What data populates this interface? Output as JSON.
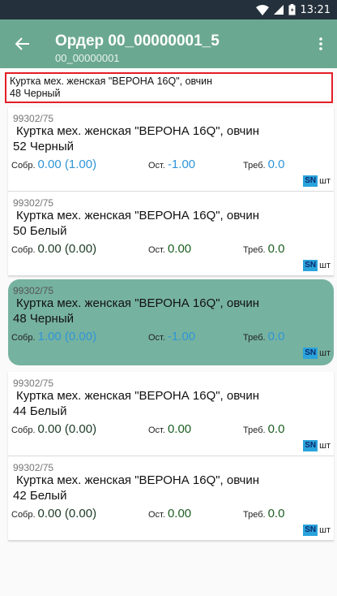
{
  "statusbar": {
    "time": "13:21"
  },
  "appbar": {
    "title": "Ордер 00_00000001_5",
    "subtitle": "00_00000001"
  },
  "selected": {
    "line1": "Куртка мех. женская \"ВЕРОНА 16Q\", овчин",
    "line2": "48 Черный"
  },
  "labels": {
    "collected": "Собр.",
    "remaining": "Ост.",
    "required": "Треб.",
    "sn": "SN",
    "unit": "шт"
  },
  "colors": {
    "blue": "#2f95d6",
    "green": "#1b5e20",
    "dark": "#1b3a24",
    "accent": "#6ba892"
  },
  "items": [
    {
      "code": "99302/75",
      "name": "Куртка мех. женская \"ВЕРОНА 16Q\", овчин",
      "variant": "52 Черный",
      "collected": "0.00 (1.00)",
      "remaining": "-1.00",
      "required": "0.0",
      "style": "blue",
      "highlight": false
    },
    {
      "code": "99302/75",
      "name": "Куртка мех. женская \"ВЕРОНА 16Q\", овчин",
      "variant": "50 Белый",
      "collected": "0.00 (0.00)",
      "remaining": "0.00",
      "required": "0.0",
      "style": "dark",
      "highlight": false
    },
    {
      "code": "99302/75",
      "name": "Куртка мех. женская \"ВЕРОНА 16Q\", овчин",
      "variant": "48 Черный",
      "collected": "1.00 (0.00)",
      "remaining": "-1.00",
      "required": "0.0",
      "style": "blue",
      "highlight": true
    },
    {
      "code": "99302/75",
      "name": "Куртка мех. женская \"ВЕРОНА 16Q\", овчин",
      "variant": "44 Белый",
      "collected": "0.00 (0.00)",
      "remaining": "0.00",
      "required": "0.0",
      "style": "dark",
      "highlight": false
    },
    {
      "code": "99302/75",
      "name": "Куртка мех. женская \"ВЕРОНА 16Q\", овчин",
      "variant": "42 Белый",
      "collected": "0.00 (0.00)",
      "remaining": "0.00",
      "required": "0.0",
      "style": "dark",
      "highlight": false
    }
  ]
}
